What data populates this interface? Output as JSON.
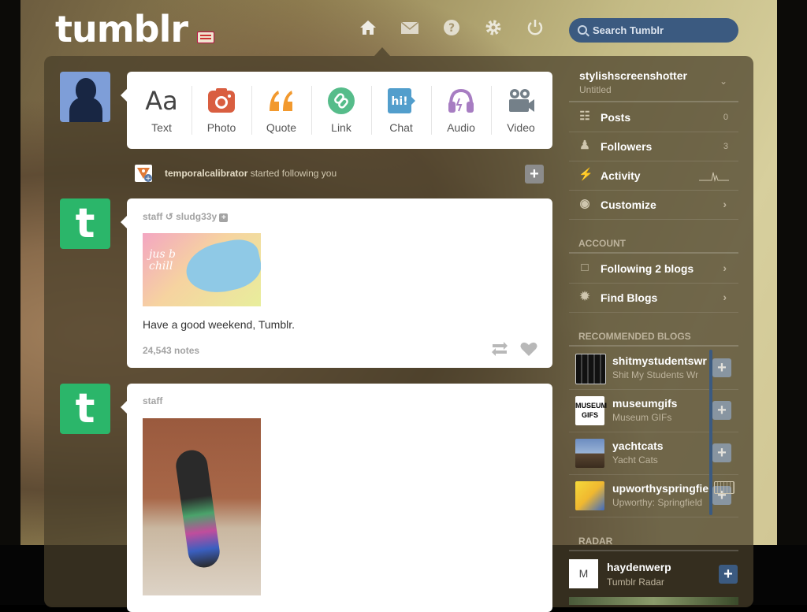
{
  "header": {
    "logo": "tumblr",
    "nav": {
      "home": "home-icon",
      "messages": "envelope-icon",
      "help": "help-icon",
      "settings": "gear-icon",
      "logout": "power-icon"
    },
    "search_placeholder": "Search Tumblr"
  },
  "post_types": [
    {
      "label": "Text",
      "icon": "text-icon",
      "color": "#444444"
    },
    {
      "label": "Photo",
      "icon": "camera-icon",
      "color": "#d95e40"
    },
    {
      "label": "Quote",
      "icon": "quote-icon",
      "color": "#f2992e"
    },
    {
      "label": "Link",
      "icon": "link-icon",
      "color": "#56bc8a"
    },
    {
      "label": "Chat",
      "icon": "chat-icon",
      "color": "#529ecc"
    },
    {
      "label": "Audio",
      "icon": "headphones-icon",
      "color": "#a77dc2"
    },
    {
      "label": "Video",
      "icon": "video-camera-icon",
      "color": "#748089"
    }
  ],
  "notification": {
    "user": "temporalcalibrator",
    "text": "started following you"
  },
  "posts": [
    {
      "author": "staff",
      "reblogged_from": "sludg33y",
      "image_caption": "jus b chill",
      "text": "Have a good weekend, Tumblr.",
      "notes": "24,543 notes"
    },
    {
      "author": "staff"
    }
  ],
  "sidebar": {
    "blog_name": "stylishscreenshotter",
    "blog_title": "Untitled",
    "items": [
      {
        "label": "Posts",
        "count": "0",
        "icon": "posts-icon"
      },
      {
        "label": "Followers",
        "count": "3",
        "icon": "followers-icon"
      },
      {
        "label": "Activity",
        "icon": "lightning-icon"
      },
      {
        "label": "Customize",
        "icon": "eye-icon"
      }
    ],
    "account_heading": "ACCOUNT",
    "account_items": [
      {
        "label": "Following 2 blogs",
        "icon": "following-icon"
      },
      {
        "label": "Find Blogs",
        "icon": "find-blogs-icon"
      }
    ],
    "recommended_heading": "RECOMMENDED BLOGS",
    "recommended": [
      {
        "name": "shitmystudentswr",
        "title": "Shit My Students Wr"
      },
      {
        "name": "museumgifs",
        "title": "Museum GIFs",
        "thumb_text": "MUSEUM GIFS"
      },
      {
        "name": "yachtcats",
        "title": "Yacht Cats"
      },
      {
        "name": "upworthyspringfie",
        "title": "Upworthy: Springfield"
      }
    ],
    "radar_heading": "RADAR",
    "radar": {
      "name": "haydenwerp",
      "source": "Tumblr Radar"
    }
  }
}
